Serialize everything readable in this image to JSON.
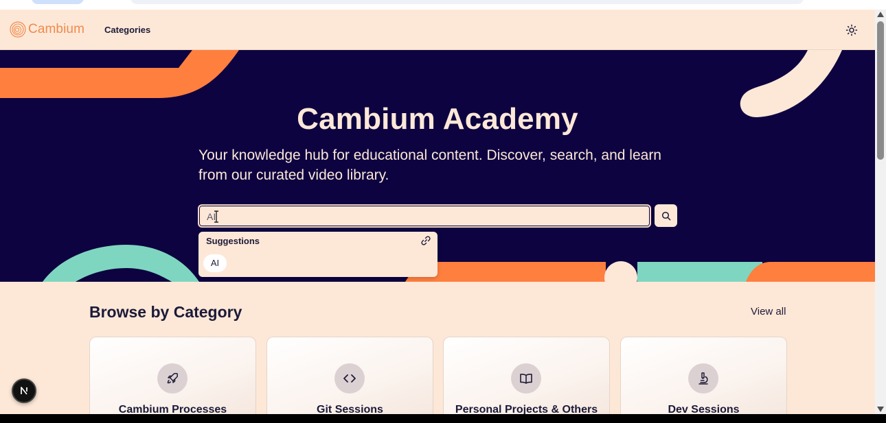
{
  "navbar": {
    "logo_text": "Cambium",
    "nav_link": "Categories",
    "theme_icon": "sun-icon"
  },
  "hero": {
    "title": "Cambium Academy",
    "subtitle": "Your knowledge hub for educational content. Discover, search, and learn from our curated video library.",
    "search": {
      "value": "AI",
      "button_icon": "search-icon"
    },
    "suggestions": {
      "header": "Suggestions",
      "header_icon": "link-icon",
      "items": [
        "AI"
      ]
    }
  },
  "section": {
    "title": "Browse by Category",
    "view_all": "View all"
  },
  "categories": [
    {
      "label": "Cambium Processes",
      "icon": "rocket-icon"
    },
    {
      "label": "Git Sessions",
      "icon": "code-icon"
    },
    {
      "label": "Personal Projects & Others",
      "icon": "book-open-icon"
    },
    {
      "label": "Dev Sessions",
      "icon": "microscope-icon"
    }
  ],
  "dev_badge": {
    "letter": "N"
  },
  "colors": {
    "page_bg": "#fde8d8",
    "hero_bg": "#0d0340",
    "accent_orange": "#ff7f3f",
    "accent_teal": "#7fd6c0",
    "text_dark": "#1c1a38",
    "brand_orange": "#f08a4b"
  }
}
